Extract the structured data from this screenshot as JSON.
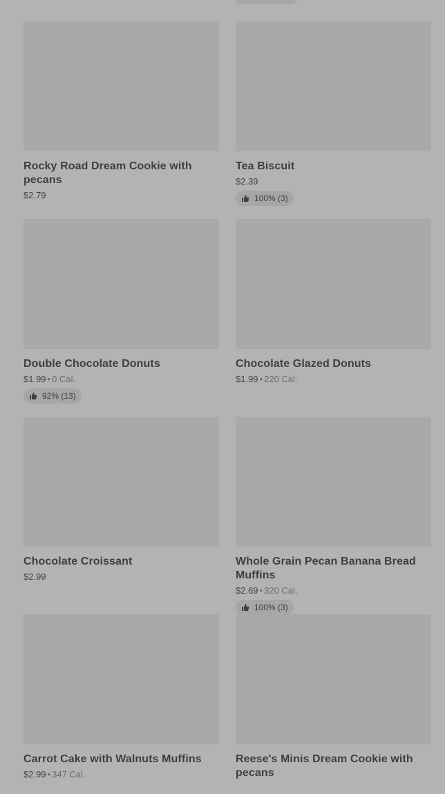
{
  "items": [
    {
      "title": "Rocky Road Dream Cookie with pecans",
      "price": "$2.79",
      "calories": "",
      "rating": ""
    },
    {
      "title": "Tea Biscuit",
      "price": "$2.39",
      "calories": "",
      "rating": "100% (3)"
    },
    {
      "title": "Double Chocolate Donuts",
      "price": "$1.99",
      "calories": "0 Cal.",
      "rating": "92% (13)"
    },
    {
      "title": "Chocolate Glazed Donuts",
      "price": "$1.99",
      "calories": "220 Cal.",
      "rating": ""
    },
    {
      "title": "Chocolate Croissant",
      "price": "$2.99",
      "calories": "",
      "rating": ""
    },
    {
      "title": "Whole Grain Pecan Banana Bread Muffins",
      "price": "$2.69",
      "calories": "320 Cal.",
      "rating": "100% (3)"
    },
    {
      "title": "Carrot Cake with Walnuts Muffins",
      "price": "$2.99",
      "calories": "347 Cal.",
      "rating": ""
    },
    {
      "title": "Reese's Minis Dream Cookie with pecans",
      "price": "",
      "calories": "",
      "rating": ""
    }
  ],
  "separator": "•",
  "icons": {
    "rating": "thumbs-up-icon"
  }
}
